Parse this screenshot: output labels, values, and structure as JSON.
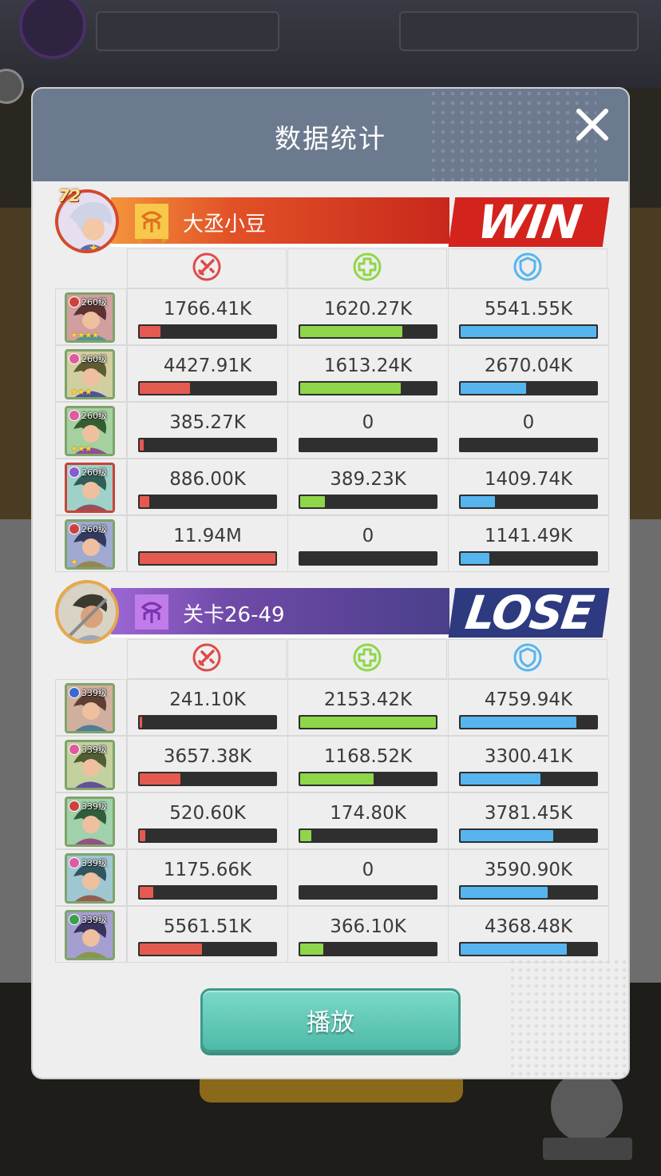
{
  "modal": {
    "title": "数据统计"
  },
  "stat_icons": [
    "attack-icon",
    "heal-icon",
    "shield-icon"
  ],
  "colors": {
    "attack": "#e55a50",
    "heal": "#8fd64a",
    "shield": "#56b5ef",
    "win": "#d4221d",
    "lose": "#2d3a80"
  },
  "team_a": {
    "level": "72",
    "name": "大丞小豆",
    "result": "WIN",
    "heroes": [
      {
        "level": "260级",
        "element": "#d0403a",
        "stars": "★★★★",
        "frame": "green",
        "attack": "1766.41K",
        "heal": "1620.27K",
        "shield": "5541.55K",
        "attack_pct": 0.15,
        "heal_pct": 0.75,
        "shield_pct": 1.0
      },
      {
        "level": "260级",
        "element": "#e05aa0",
        "stars": "★★★",
        "frame": "green",
        "attack": "4427.91K",
        "heal": "1613.24K",
        "shield": "2670.04K",
        "attack_pct": 0.37,
        "heal_pct": 0.74,
        "shield_pct": 0.48
      },
      {
        "level": "260级",
        "element": "#e05aa0",
        "stars": "★★★",
        "frame": "green",
        "attack": "385.27K",
        "heal": "0",
        "shield": "0",
        "attack_pct": 0.03,
        "heal_pct": 0.0,
        "shield_pct": 0.0
      },
      {
        "level": "260级",
        "element": "#8a5ad0",
        "stars": "",
        "frame": "red",
        "attack": "886.00K",
        "heal": "389.23K",
        "shield": "1409.74K",
        "attack_pct": 0.07,
        "heal_pct": 0.18,
        "shield_pct": 0.25
      },
      {
        "level": "260级",
        "element": "#d0403a",
        "stars": "★",
        "frame": "green",
        "attack": "11.94M",
        "heal": "0",
        "shield": "1141.49K",
        "attack_pct": 1.0,
        "heal_pct": 0.0,
        "shield_pct": 0.21
      }
    ]
  },
  "team_b": {
    "name": "关卡26-49",
    "result": "LOSE",
    "heroes": [
      {
        "level": "339级",
        "element": "#3a6ad0",
        "stars": "",
        "frame": "green",
        "attack": "241.10K",
        "heal": "2153.42K",
        "shield": "4759.94K",
        "attack_pct": 0.02,
        "heal_pct": 1.0,
        "shield_pct": 0.85
      },
      {
        "level": "339级",
        "element": "#e05aa0",
        "stars": "",
        "frame": "green",
        "attack": "3657.38K",
        "heal": "1168.52K",
        "shield": "3300.41K",
        "attack_pct": 0.3,
        "heal_pct": 0.54,
        "shield_pct": 0.59
      },
      {
        "level": "339级",
        "element": "#d0403a",
        "stars": "",
        "frame": "green",
        "attack": "520.60K",
        "heal": "174.80K",
        "shield": "3781.45K",
        "attack_pct": 0.04,
        "heal_pct": 0.08,
        "shield_pct": 0.68
      },
      {
        "level": "339级",
        "element": "#e05aa0",
        "stars": "",
        "frame": "green",
        "attack": "1175.66K",
        "heal": "0",
        "shield": "3590.90K",
        "attack_pct": 0.1,
        "heal_pct": 0.0,
        "shield_pct": 0.64
      },
      {
        "level": "339级",
        "element": "#3aa04a",
        "stars": "",
        "frame": "green",
        "attack": "5561.51K",
        "heal": "366.10K",
        "shield": "4368.48K",
        "attack_pct": 0.46,
        "heal_pct": 0.17,
        "shield_pct": 0.78
      }
    ]
  },
  "play_button": {
    "label": "播放"
  }
}
